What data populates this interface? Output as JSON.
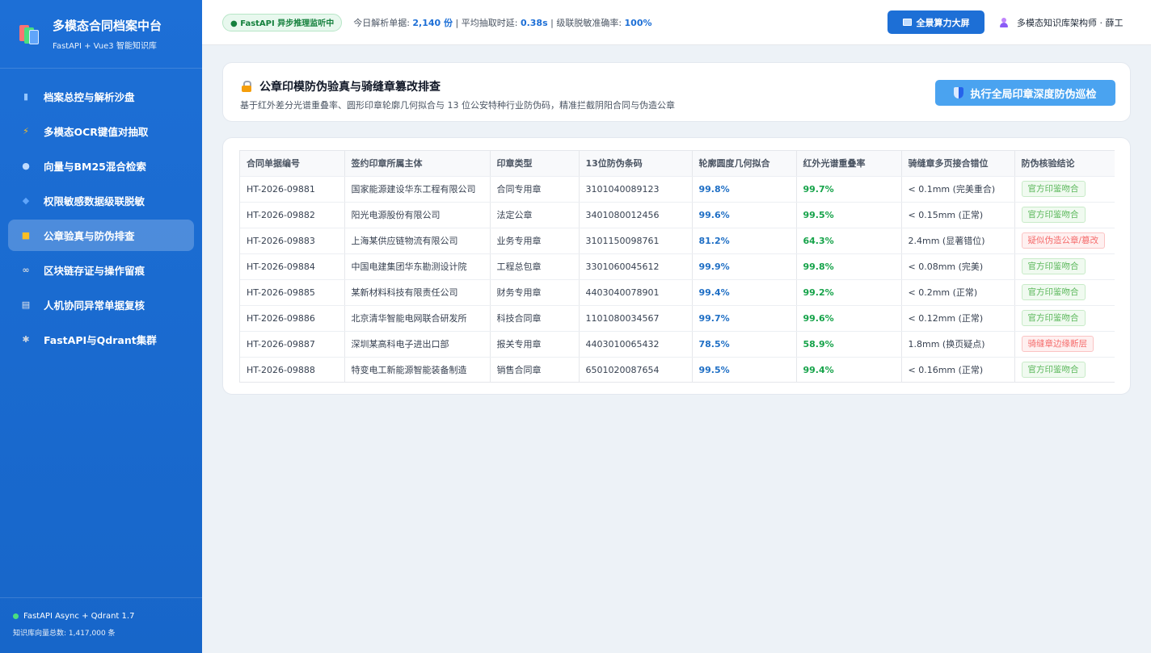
{
  "sidebar": {
    "brand_title": "多模态合同档案中台",
    "brand_sub": "FastAPI + Vue3 智能知识库",
    "items": [
      {
        "label": "档案总控与解析沙盘",
        "icon": "bar-chart-icon",
        "glyph": "▮"
      },
      {
        "label": "多模态OCR键值对抽取",
        "icon": "lightning-icon",
        "glyph": "⚡"
      },
      {
        "label": "向量与BM25混合检索",
        "icon": "magnifier-icon",
        "glyph": "●"
      },
      {
        "label": "权限敏感数据级联脱敏",
        "icon": "shield-icon",
        "glyph": "◆"
      },
      {
        "label": "公章验真与防伪排查",
        "icon": "lock-icon",
        "glyph": "■",
        "active": true
      },
      {
        "label": "区块链存证与操作留痕",
        "icon": "link-icon",
        "glyph": "∞"
      },
      {
        "label": "人机协同异常单据复核",
        "icon": "clipboard-icon",
        "glyph": "▤"
      },
      {
        "label": "FastAPI与Qdrant集群",
        "icon": "gear-icon",
        "glyph": "✱"
      }
    ],
    "footer_status": "FastAPI Async + Qdrant 1.7",
    "footer_count": "知识库向量总数: 1,417,000 条"
  },
  "topbar": {
    "live_label": "● FastAPI 异步推理监听中",
    "stat1_label": "今日解析单据: ",
    "stat1_value": "2,140 份",
    "stat2_label": " | 平均抽取时延: ",
    "stat2_value": "0.38s",
    "stat3_label": " | 级联脱敏准确率: ",
    "stat3_value": "100%",
    "screen_button": "全景算力大屏",
    "user_name": "多模态知识库架构师 · 薛工"
  },
  "header": {
    "title": "公章印模防伪验真与骑缝章篡改排查",
    "desc": "基于红外差分光谱重叠率、圆形印章轮廓几何拟合与 13 位公安特种行业防伪码，精准拦截阴阳合同与伪造公章",
    "action_button": "执行全局印章深度防伪巡检"
  },
  "table": {
    "columns": [
      "合同单据编号",
      "签约印章所属主体",
      "印章类型",
      "13位防伪条码",
      "轮廓圆度几何拟合",
      "红外光谱重叠率",
      "骑缝章多页接合错位",
      "防伪核验结论"
    ],
    "rows": [
      {
        "id": "HT-2026-09881",
        "entity": "国家能源建设华东工程有限公司",
        "type": "合同专用章",
        "code": "3101040089123",
        "fit": "99.8%",
        "ir": "99.7%",
        "offset": "< 0.1mm (完美重合)",
        "verdict": "官方印鉴吻合",
        "ok": true
      },
      {
        "id": "HT-2026-09882",
        "entity": "阳光电源股份有限公司",
        "type": "法定公章",
        "code": "3401080012456",
        "fit": "99.6%",
        "ir": "99.5%",
        "offset": "< 0.15mm (正常)",
        "verdict": "官方印鉴吻合",
        "ok": true
      },
      {
        "id": "HT-2026-09883",
        "entity": "上海某供应链物流有限公司",
        "type": "业务专用章",
        "code": "3101150098761",
        "fit": "81.2%",
        "ir": "64.3%",
        "offset": "2.4mm (显著错位)",
        "verdict": "疑似伪造公章/篡改",
        "ok": false
      },
      {
        "id": "HT-2026-09884",
        "entity": "中国电建集团华东勘测设计院",
        "type": "工程总包章",
        "code": "3301060045612",
        "fit": "99.9%",
        "ir": "99.8%",
        "offset": "< 0.08mm (完美)",
        "verdict": "官方印鉴吻合",
        "ok": true
      },
      {
        "id": "HT-2026-09885",
        "entity": "某新材料科技有限责任公司",
        "type": "财务专用章",
        "code": "4403040078901",
        "fit": "99.4%",
        "ir": "99.2%",
        "offset": "< 0.2mm (正常)",
        "verdict": "官方印鉴吻合",
        "ok": true
      },
      {
        "id": "HT-2026-09886",
        "entity": "北京清华智能电网联合研发所",
        "type": "科技合同章",
        "code": "1101080034567",
        "fit": "99.7%",
        "ir": "99.6%",
        "offset": "< 0.12mm (正常)",
        "verdict": "官方印鉴吻合",
        "ok": true
      },
      {
        "id": "HT-2026-09887",
        "entity": "深圳某高科电子进出口部",
        "type": "报关专用章",
        "code": "4403010065432",
        "fit": "78.5%",
        "ir": "58.9%",
        "offset": "1.8mm (换页疑点)",
        "verdict": "骑缝章边缘断层",
        "ok": false
      },
      {
        "id": "HT-2026-09888",
        "entity": "特变电工新能源智能装备制造",
        "type": "销售合同章",
        "code": "6501020087654",
        "fit": "99.5%",
        "ir": "99.4%",
        "offset": "< 0.16mm (正常)",
        "verdict": "官方印鉴吻合",
        "ok": true
      }
    ]
  }
}
